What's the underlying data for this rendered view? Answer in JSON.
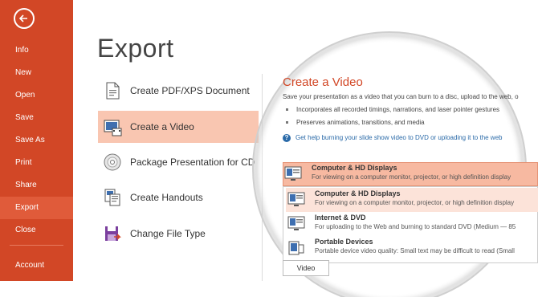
{
  "sidebar": {
    "items": [
      {
        "label": "Info",
        "active": false
      },
      {
        "label": "New",
        "active": false
      },
      {
        "label": "Open",
        "active": false
      },
      {
        "label": "Save",
        "active": false
      },
      {
        "label": "Save As",
        "active": false
      },
      {
        "label": "Print",
        "active": false
      },
      {
        "label": "Share",
        "active": false
      },
      {
        "label": "Export",
        "active": true
      },
      {
        "label": "Close",
        "active": false
      }
    ],
    "account_label": "Account",
    "color": "#D24726"
  },
  "page_title": "Export",
  "export_options": [
    {
      "label": "Create PDF/XPS Document",
      "icon": "pdf-document-icon"
    },
    {
      "label": "Create a Video",
      "icon": "video-icon",
      "active": true
    },
    {
      "label": "Package Presentation for CD",
      "icon": "cd-icon"
    },
    {
      "label": "Create Handouts",
      "icon": "handouts-icon"
    },
    {
      "label": "Change File Type",
      "icon": "file-type-icon"
    }
  ],
  "video_panel": {
    "title": "Create a Video",
    "description": "Save your presentation as a video that you can burn to a disc, upload to the web, o",
    "bullets": [
      "Incorporates all recorded timings, narrations, and laser pointer gestures",
      "Preserves animations, transitions, and media"
    ],
    "help_link": "Get help burning your slide show video to DVD or uploading it to the web",
    "selected_quality": {
      "title": "Computer & HD Displays",
      "subtitle": "For viewing on a computer monitor, projector, or high definition display"
    },
    "quality_options": [
      {
        "title": "Computer & HD Displays",
        "subtitle": "For viewing on a computer monitor, projector, or high definition display"
      },
      {
        "title": "Internet & DVD",
        "subtitle": "For uploading to the Web and burning to standard DVD  (Medium — 85"
      },
      {
        "title": "Portable Devices",
        "subtitle": "Portable device video quality: Small text may be difficult to read  (Small"
      }
    ],
    "video_button": "Video"
  }
}
